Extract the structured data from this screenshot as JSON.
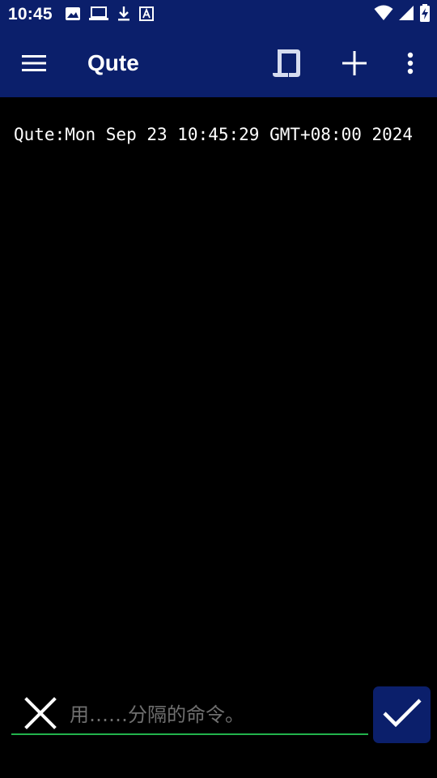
{
  "status_bar": {
    "time": "10:45",
    "left_icons": [
      "image-icon",
      "laptop-icon",
      "download-icon",
      "text-icon"
    ],
    "right_icons": [
      "wifi-icon",
      "signal-icon",
      "battery-charging-icon"
    ]
  },
  "app_bar": {
    "title": "Qute",
    "icons": [
      "menu-icon",
      "session-icon",
      "add-icon",
      "more-vert-icon"
    ]
  },
  "terminal": {
    "lines": [
      "Qute:Mon Sep 23 10:45:29 GMT+08:00 2024"
    ]
  },
  "command_bar": {
    "placeholder": "用……分隔的命令。",
    "value": "",
    "icons": [
      "close-icon",
      "check-icon"
    ]
  },
  "colors": {
    "bar_background": "#0b1f6b",
    "terminal_background": "#000000",
    "terminal_text": "#ffffff",
    "input_underline": "#22b24c",
    "placeholder_text": "#6f6f6f"
  }
}
